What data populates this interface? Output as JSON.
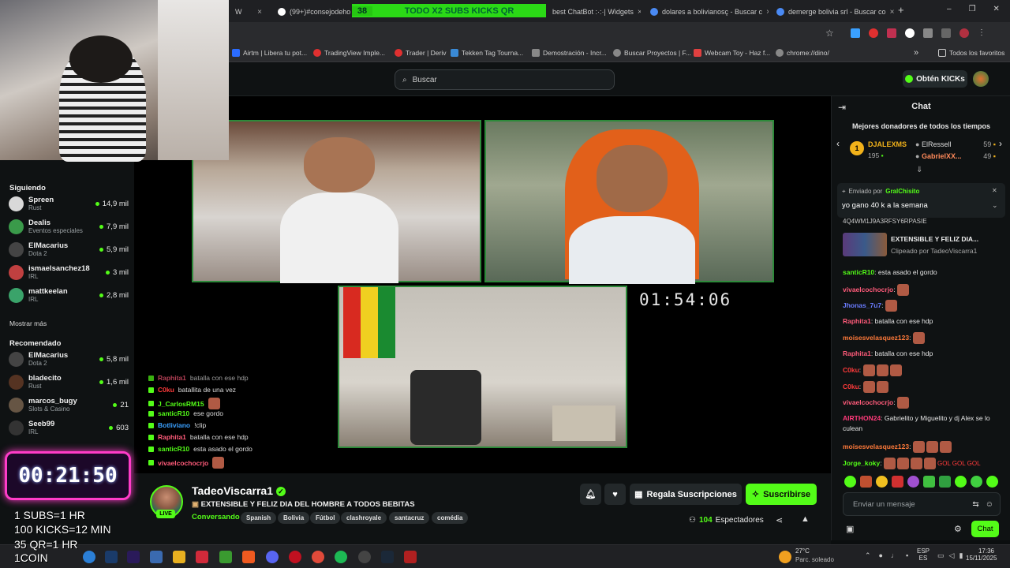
{
  "tabs": [
    {
      "label": "(99+)#consejodehomb",
      "x": ""
    },
    {
      "label": "best ChatBot :·:·| Widgets"
    },
    {
      "label": "dolares a bolivianosç - Buscar c"
    },
    {
      "label": "demerge bolivia srl - Buscar co"
    }
  ],
  "banner": {
    "num": "38",
    "text": "TODO X2 SUBS KICKS QR"
  },
  "bookmarks": [
    {
      "label": "Airtm | Libera tu pot...",
      "color": "#2b6cff"
    },
    {
      "label": "TradingView Imple...",
      "color": "#e03030"
    },
    {
      "label": "Trader | Deriv",
      "color": "#e03030"
    },
    {
      "label": "Tekken Tag Tourna...",
      "color": "#3a8ad6"
    },
    {
      "label": "Demostración - Incr...",
      "color": "#888888"
    },
    {
      "label": "Buscar Proyectos | F...",
      "color": "#888888"
    },
    {
      "label": "Webcam Toy - Haz f...",
      "color": "#e04040"
    },
    {
      "label": "chrome://dino/",
      "color": "#888888"
    }
  ],
  "bookmarks_all": "Todos los favoritos",
  "header": {
    "search_placeholder": "Buscar",
    "get_kicks": "Obtén KICKs"
  },
  "sidebar": {
    "following_title": "Siguiendo",
    "following": [
      {
        "name": "Spreen",
        "sub": "Rust",
        "viewers": "14,9 mil",
        "color": "#d9d9d9"
      },
      {
        "name": "Dealis",
        "sub": "Eventos especiales",
        "viewers": "7,9 mil",
        "color": "#3a9a4a"
      },
      {
        "name": "ElMacarius",
        "sub": "Dota 2",
        "viewers": "5,9 mil",
        "color": "#444"
      },
      {
        "name": "ismaelsanchez18",
        "sub": "IRL",
        "viewers": "3 mil",
        "color": "#c04040"
      },
      {
        "name": "mattkeelan",
        "sub": "IRL",
        "viewers": "2,8 mil",
        "color": "#3aa36a"
      }
    ],
    "show_more": "Mostrar más",
    "recommended_title": "Recomendado",
    "recommended": [
      {
        "name": "ElMacarius",
        "sub": "Dota 2",
        "viewers": "5,8 mil",
        "color": "#444"
      },
      {
        "name": "bladecito",
        "sub": "Rust",
        "viewers": "1,6 mil",
        "color": "#553322"
      },
      {
        "name": "marcos_bugy",
        "sub": "Slots & Casino",
        "viewers": "21",
        "color": "#664"
      },
      {
        "name": "Seeb99",
        "sub": "IRL",
        "viewers": "603",
        "color": "#333"
      }
    ]
  },
  "stream": {
    "timer": "01:54:06",
    "overlay_chat": [
      {
        "user": "Raphita1",
        "text": "batalla con ese hdp",
        "color": "#ff5b7a"
      },
      {
        "user": "C0ku",
        "text": "batallita de una vez",
        "color": "#ff3a3a"
      },
      {
        "user": "J_CarlosRM15",
        "text": "",
        "color": "#53fc18"
      },
      {
        "user": "santicR10",
        "text": "ese gordo",
        "color": "#53fc18"
      },
      {
        "user": "Botliviano",
        "text": "!clip",
        "color": "#3aa0ff"
      },
      {
        "user": "Raphita1",
        "text": "batalla con ese hdp",
        "color": "#ff5b7a"
      },
      {
        "user": "santicR10",
        "text": "esta asado el gordo",
        "color": "#53fc18"
      },
      {
        "user": "vivaelcochocrjo",
        "text": "",
        "color": "#ff5b7a"
      }
    ]
  },
  "overlay": {
    "sub_timer": "00:21:50",
    "lines": [
      "1 SUBS=1 HR",
      "100 KICKS=12 MIN",
      "35 QR=1 HR",
      "1COIN"
    ]
  },
  "channel": {
    "name": "TadeoViscarra1",
    "live": "LIVE",
    "title": "EXTENSIBLE Y FELIZ DIA DEL HOMBRE A TODOS BEBITAS",
    "category": "Conversando",
    "tags": [
      "Spanish",
      "Bolivia",
      "Fútbol",
      "clashroyale",
      "santacruz",
      "comédia"
    ],
    "gift_subs": "Regala Suscripciones",
    "subscribe": "Suscribirse",
    "viewers": "104",
    "viewers_label": "Espectadores"
  },
  "chat": {
    "title": "Chat",
    "top_donors_title": "Mejores donadores de todos los tiempos",
    "donors": [
      {
        "rank": "1",
        "name": "DJALEXMS",
        "amount": "195"
      },
      {
        "name": "ElRessell",
        "amount": "59"
      },
      {
        "name": "GabrielXX...",
        "amount": "49"
      }
    ],
    "pinned_by_label": "Enviado por",
    "pinned_by": "GralChisito",
    "pinned_text": "yo gano 40 k a la semana",
    "partial_line": "4Q4WM1J9A3RFSY6RPASIE",
    "clip_title": "EXTENSIBLE Y FELIZ DIA...",
    "clip_by": "Clipeado por TadeoViscarra1",
    "messages": [
      {
        "user": "santicR10",
        "text": "esta asado el gordo",
        "color": "#53fc18",
        "emotes": 0
      },
      {
        "user": "vivaelcochocrjo",
        "text": "",
        "color": "#ff5b7a",
        "emotes": 1
      },
      {
        "user": "Jhonas_7u7",
        "text": "",
        "color": "#6a7cff",
        "emotes": 1
      },
      {
        "user": "Raphita1",
        "text": "batalla con ese hdp",
        "color": "#ff5b7a",
        "emotes": 0
      },
      {
        "user": "moisesvelasquez123",
        "text": "",
        "color": "#ff7a3a",
        "emotes": 1
      },
      {
        "user": "Raphita1",
        "text": "batalla con ese hdp",
        "color": "#ff5b7a",
        "emotes": 0
      },
      {
        "user": "C0ku",
        "text": "",
        "color": "#ff3a3a",
        "emotes": 3
      },
      {
        "user": "C0ku",
        "text": "",
        "color": "#ff3a3a",
        "emotes": 2
      },
      {
        "user": "vivaelcochocrjo",
        "text": "",
        "color": "#ff5b7a",
        "emotes": 1
      },
      {
        "user": "AIRTHON24",
        "text": "Gabrielito y Miguelito y dj Alex se lo culean",
        "color": "#ff3a7a",
        "emotes": 0
      },
      {
        "user": "moisesvelasquez123",
        "text": "",
        "color": "#ff7a3a",
        "emotes": 3
      },
      {
        "user": "Jorge_koky",
        "text": "GOL GOL GOL",
        "color": "#53fc18",
        "emotes": 4
      }
    ],
    "input_placeholder": "Enviar un mensaje",
    "send": "Chat"
  },
  "taskbar": {
    "weather_temp": "27°C",
    "weather_desc": "Parc. soleado",
    "lang": "ESP",
    "lang2": "ES",
    "time": "17:36",
    "date": "15/11/2025"
  },
  "colors": {
    "accent": "#53fc18",
    "bg": "#0b0e0f",
    "panel": "#0f1213"
  }
}
